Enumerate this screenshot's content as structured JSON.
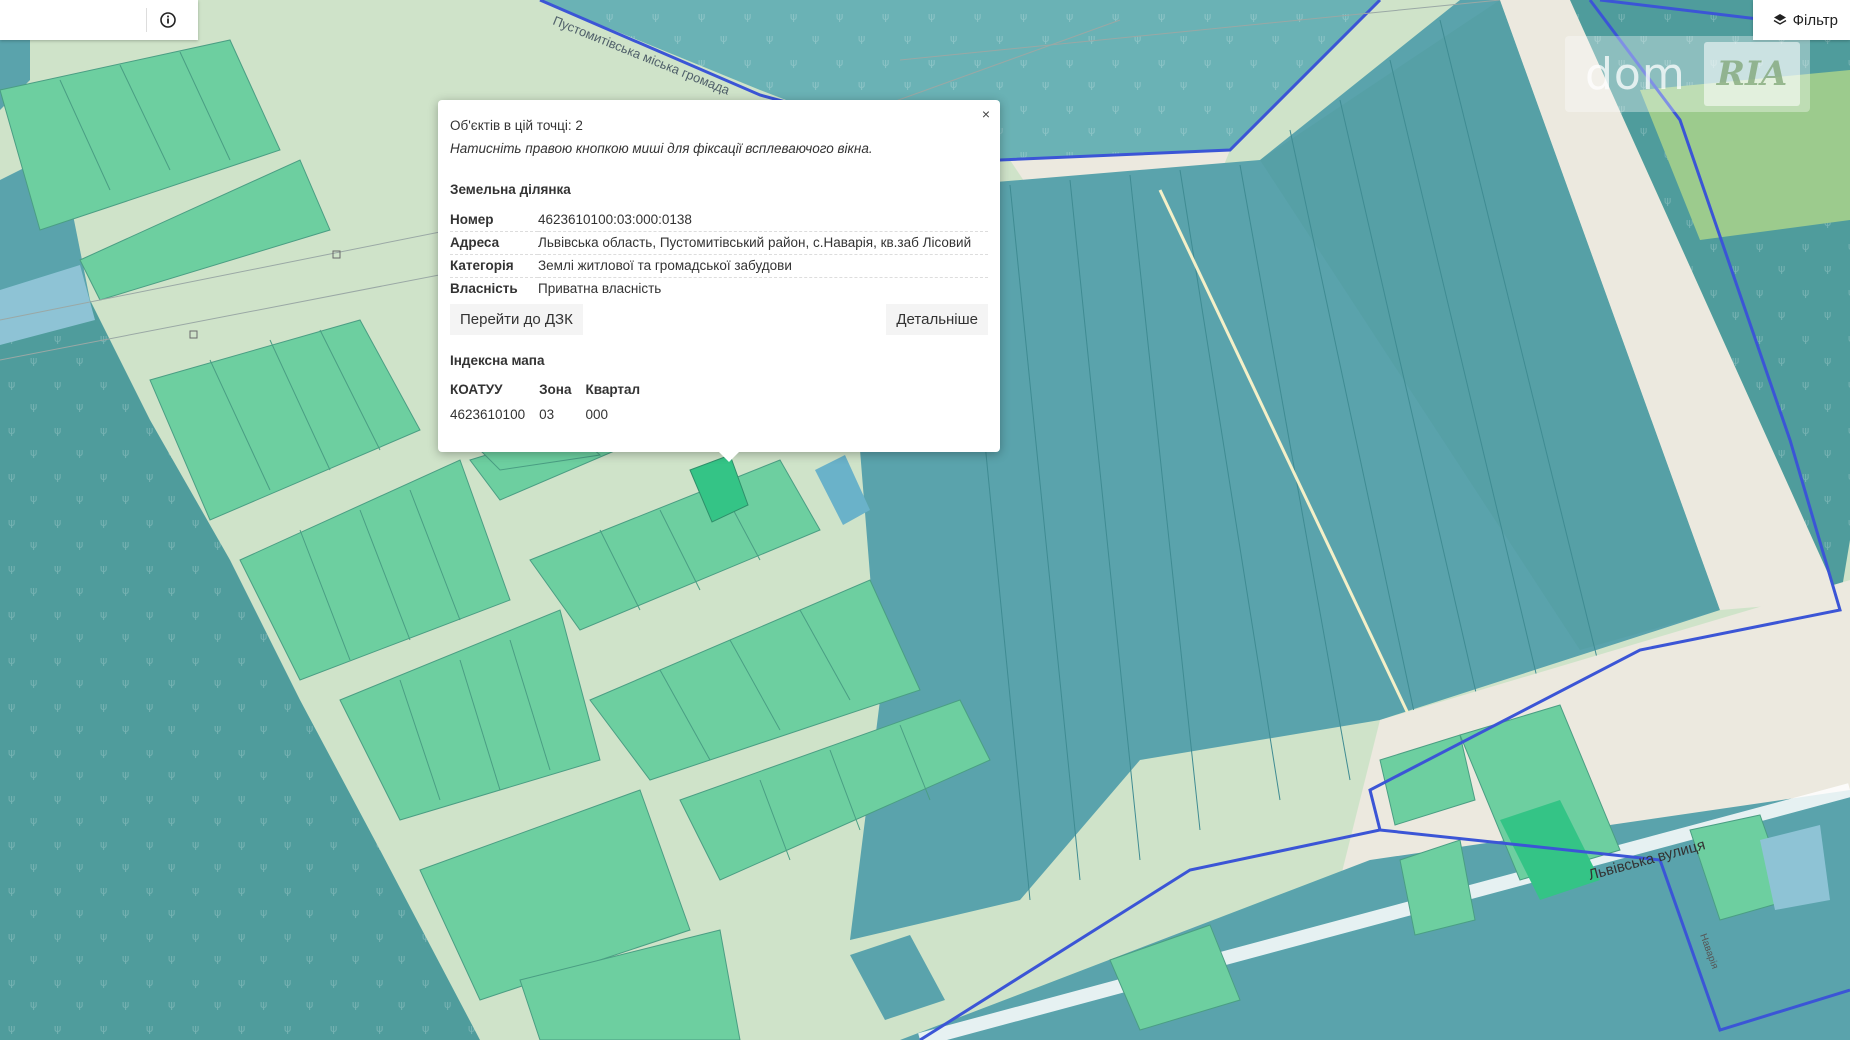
{
  "toolbar": {
    "filter_label": "Фільтр",
    "filter_icon": "layers-icon",
    "info_icon": "info-icon"
  },
  "watermark": {
    "text": "dom",
    "logo_text": "RIA"
  },
  "map_labels": {
    "community": "Пустомитівська міська громада",
    "street": "Львівська вулиця",
    "street_small": "Наварія"
  },
  "colors": {
    "plot_fill": "#6dcfa0",
    "large_parcel_fill": "#5aa3ac",
    "boundary_line": "#3b55d6",
    "road": "#ece9df",
    "highlight": "#34c486"
  },
  "popup": {
    "close_label": "×",
    "count_label": "Об'єктів в цій точці: 2",
    "hint": "Натисніть правою кнопкою миші для фіксації всплеваючого вікна.",
    "parcel_title": "Земельна ділянка",
    "attributes": [
      {
        "key": "Номер",
        "value": "4623610100:03:000:0138"
      },
      {
        "key": "Адреса",
        "value": "Львівська область, Пустомитівський район, с.Наварія, кв.заб Лісовий"
      },
      {
        "key": "Категорія",
        "value": "Землі житлової та громадської забудови"
      },
      {
        "key": "Власність",
        "value": "Приватна власність"
      }
    ],
    "goto_dzk": "Перейти до ДЗК",
    "details": "Детальніше",
    "index_title": "Індексна мапа",
    "index_headers": [
      "КОАТУУ",
      "Зона",
      "Квартал"
    ],
    "index_values": [
      "4623610100",
      "03",
      "000"
    ]
  }
}
